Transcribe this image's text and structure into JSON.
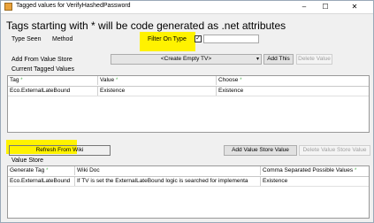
{
  "window": {
    "title": "Tagged values for VerifyHashedPassword",
    "minimize": "–",
    "maximize": "☐",
    "close": "✕"
  },
  "heading": "Tags starting with * will be code generated as .net attributes",
  "row1": {
    "type_seen_label": "Type Seen",
    "type_seen_value": "Method",
    "filter_label": "Filter On Type",
    "filter_checked": "✓"
  },
  "row2": {
    "add_from_label": "Add From Value Store",
    "combo_value": "<Create Empty TV>",
    "combo_arrow": "▾",
    "add_this": "Add This",
    "delete_value": "Delete Value"
  },
  "current_grid": {
    "caption": "Current Tagged Values",
    "columns": [
      "Tag",
      "Value",
      "Choose"
    ],
    "star": "*",
    "rows": [
      [
        "Eco.ExternalLateBound",
        "Existence",
        "Existence"
      ]
    ]
  },
  "buttons": {
    "refresh": "Refresh From Wiki",
    "add_store": "Add Value Store Value",
    "delete_store": "Delete Value Store Value"
  },
  "store_grid": {
    "caption": "Value Store",
    "columns": [
      "Generate Tag",
      "Wiki Doc",
      "Comma Separated Possible Values"
    ],
    "star": "*",
    "rows": [
      [
        "Eco.ExternalLateBound",
        "If TV is set the ExternalLateBound logic is searched for implementa",
        "Existence"
      ]
    ]
  }
}
